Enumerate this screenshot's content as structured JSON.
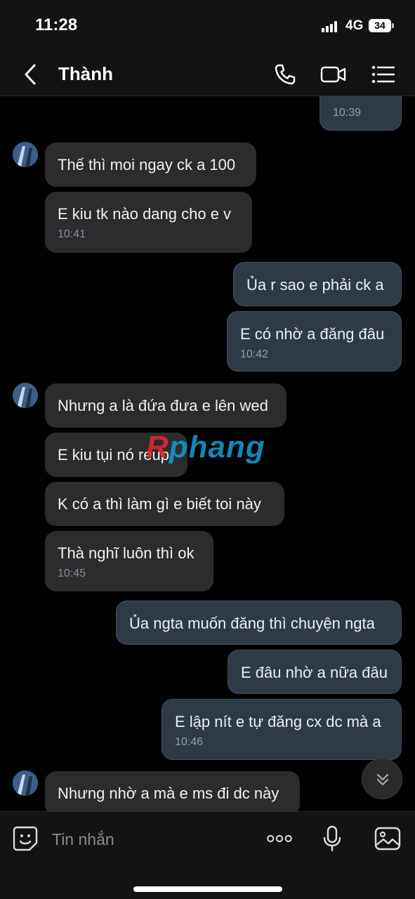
{
  "status_bar": {
    "time": "11:28",
    "network": "4G",
    "battery": "34"
  },
  "header": {
    "contact_name": "Thành"
  },
  "messages": [
    {
      "dir": "out",
      "text": "",
      "time": "10:39"
    },
    {
      "dir": "in",
      "text": "Thế thì moi ngay ck a 100",
      "time": ""
    },
    {
      "dir": "in",
      "text": "E kiu tk nào dang cho e v",
      "time": "10:41"
    },
    {
      "dir": "out",
      "text": "Ủa r sao e phải ck a",
      "time": ""
    },
    {
      "dir": "out",
      "text": "E có nhờ a đăng đâu",
      "time": "10:42"
    },
    {
      "dir": "in",
      "text": "Nhưng a là đứa đưa e lên wed",
      "time": ""
    },
    {
      "dir": "in",
      "text": "E kiu tụi nó reup",
      "time": ""
    },
    {
      "dir": "in",
      "text": "K có a thì làm gì e biết toi này",
      "time": ""
    },
    {
      "dir": "in",
      "text": "Thà nghĩ luôn thì ok",
      "time": "10:45"
    },
    {
      "dir": "out",
      "text": "Ủa ngta muốn đăng thì chuyện ngta",
      "time": ""
    },
    {
      "dir": "out",
      "text": "E đâu nhờ a nữa đâu",
      "time": ""
    },
    {
      "dir": "out",
      "text": "E lập nít e tự đăng cx dc mà a",
      "time": "10:46"
    },
    {
      "dir": "in",
      "text": "Nhưng nhờ a mà e ms đi dc này",
      "time": ""
    }
  ],
  "watermark": {
    "first": "R",
    "rest": "phang"
  },
  "input": {
    "placeholder": "Tin nhắn"
  },
  "colors": {
    "background": "#000000",
    "incoming_bubble": "#2c2c2e",
    "outgoing_bubble": "#2e3b47"
  }
}
